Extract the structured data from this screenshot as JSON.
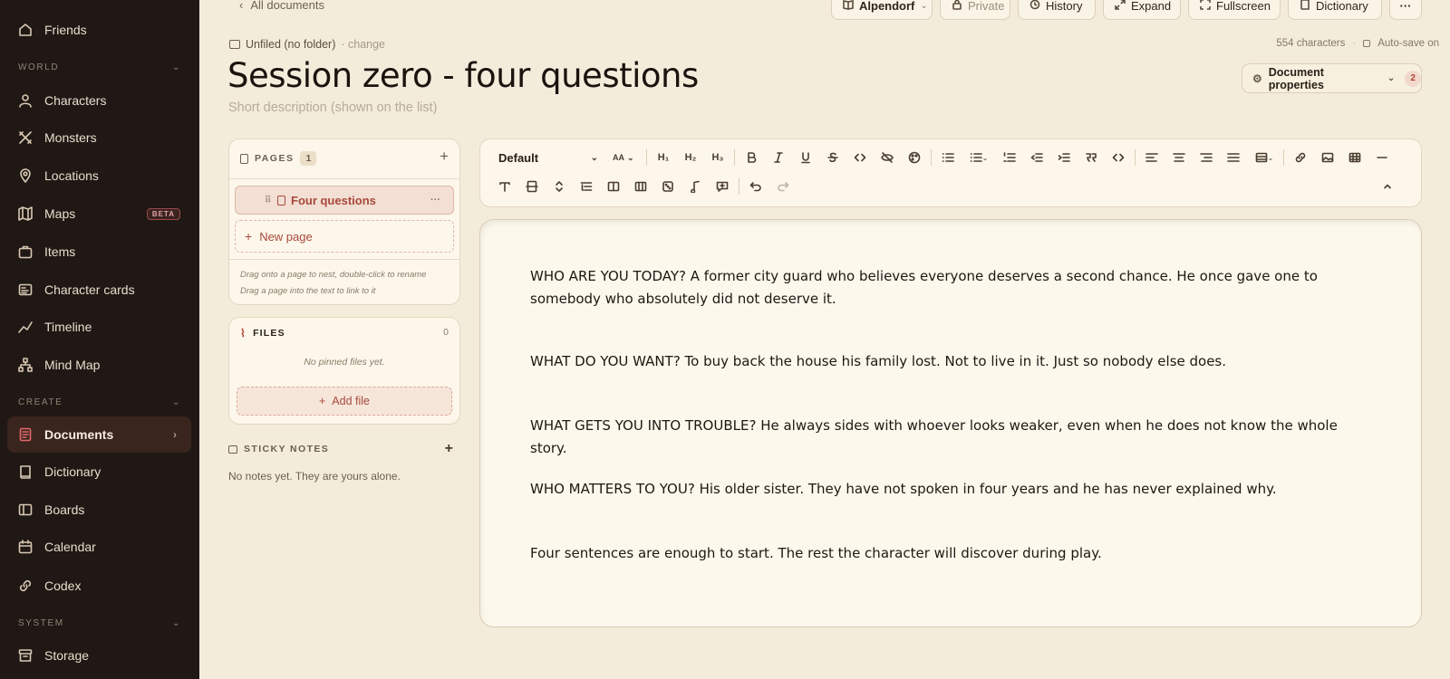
{
  "sidebar": {
    "friends": "Friends",
    "world_label": "WORLD",
    "world": [
      "Characters",
      "Monsters",
      "Locations",
      "Maps",
      "Items",
      "Character cards",
      "Timeline",
      "Mind Map"
    ],
    "beta": "BETA",
    "create_label": "CREATE",
    "create": [
      "Documents",
      "Dictionary",
      "Boards",
      "Calendar",
      "Codex"
    ],
    "system_label": "SYSTEM",
    "system": [
      "Storage"
    ]
  },
  "topbar": {
    "back": "All documents",
    "world_select": "Alpendorf",
    "private": "Private",
    "history": "History",
    "expand": "Expand",
    "fullscreen": "Fullscreen",
    "dictionary": "Dictionary",
    "more": "···"
  },
  "doc": {
    "folder": "Unfiled (no folder)",
    "change": "· change",
    "char_count": "554 characters",
    "autosave": "Auto-save on",
    "title": "Session zero - four questions",
    "description_placeholder": "Short description (shown on the list)",
    "properties": "Document properties",
    "properties_count": "2"
  },
  "pages_panel": {
    "label": "PAGES",
    "count": "1",
    "active_page": "Four questions",
    "new_page": "New page",
    "hint1": "Drag onto a page to nest, double-click to rename",
    "hint2": "Drag a page into the text to link to it"
  },
  "files_panel": {
    "label": "FILES",
    "count": "0",
    "empty": "No pinned files yet.",
    "add": "Add file"
  },
  "sticky": {
    "label": "STICKY NOTES",
    "empty": "No notes yet. They are yours alone."
  },
  "toolbar": {
    "style": "Default",
    "size": "AA",
    "h1": "H₁",
    "h2": "H₂",
    "h3": "H₃"
  },
  "content": [
    "WHO ARE YOU TODAY? A former city guard who believes everyone deserves a second chance. He once gave one to somebody who absolutely did not deserve it.",
    "WHAT DO YOU WANT? To buy back the house his family lost. Not to live in it. Just so nobody else does.",
    "WHAT GETS YOU INTO TROUBLE? He always sides with whoever looks weaker, even when he does not know the whole story.",
    "WHO MATTERS TO YOU? His older sister. They have not spoken in four years and he has never explained why.",
    "Four sentences are enough to start. The rest the character will discover during play."
  ]
}
